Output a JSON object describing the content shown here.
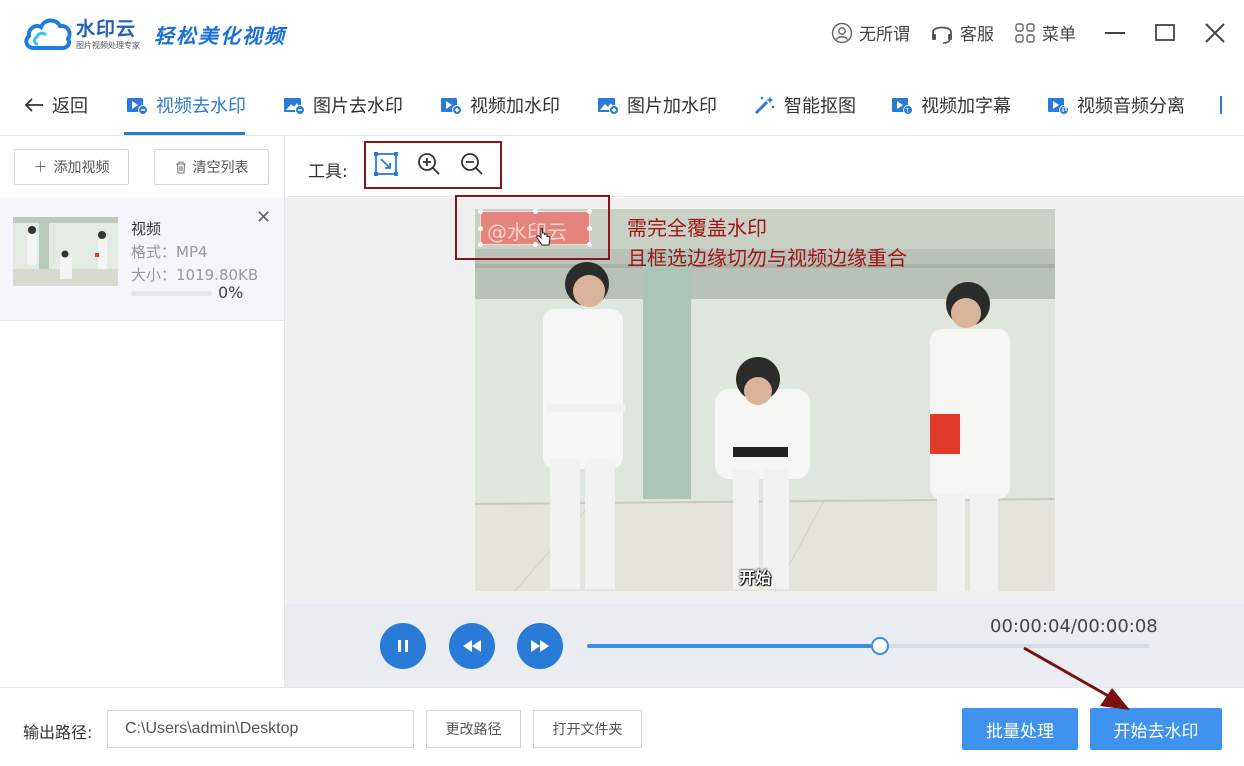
{
  "app": {
    "brand_name": "水印云",
    "brand_sub": "图片视频处理专家",
    "slogan": "轻松美化视频",
    "account_label": "无所谓",
    "service_label": "客服",
    "menu_label": "菜单"
  },
  "nav": {
    "back_label": "返回",
    "tabs": [
      {
        "label": "视频去水印",
        "active": true
      },
      {
        "label": "图片去水印"
      },
      {
        "label": "视频加水印"
      },
      {
        "label": "图片加水印"
      },
      {
        "label": "智能抠图"
      },
      {
        "label": "视频加字幕"
      },
      {
        "label": "视频音频分离"
      }
    ]
  },
  "left": {
    "add_video_label": "添加视频",
    "clear_list_label": "清空列表",
    "file": {
      "name": "视频",
      "format": "格式：MP4",
      "size": "大小：1019.80KB",
      "progress_text": "0%",
      "progress": 0
    }
  },
  "toolbar": {
    "label": "工具:"
  },
  "preview": {
    "watermark_text": "@水印云",
    "subtitle": "开始",
    "annotation_line1": "需完全覆盖水印",
    "annotation_line2": "且框选边缘切勿与视频边缘重合"
  },
  "player": {
    "time": "00:00:04/00:00:08",
    "progress": 0.52
  },
  "bottom": {
    "output_label": "输出路径:",
    "output_path": "C:\\Users\\admin\\Desktop",
    "change_path_label": "更改路径",
    "open_folder_label": "打开文件夹",
    "batch_label": "批量处理",
    "start_label": "开始去水印"
  },
  "colors": {
    "accent": "#2a7bd8",
    "primary_button": "#3f93ee",
    "annotation": "#8a1717"
  }
}
